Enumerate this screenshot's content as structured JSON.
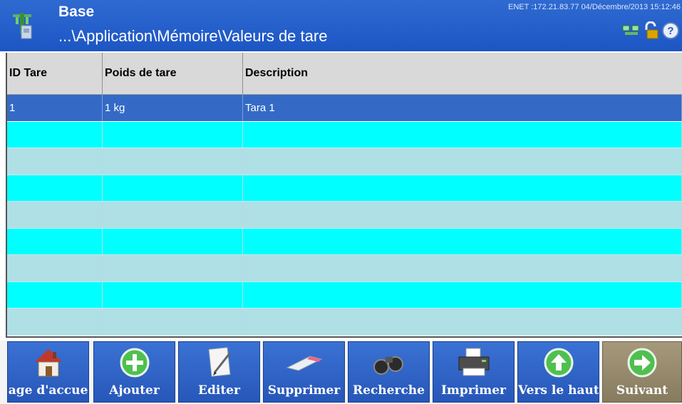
{
  "header": {
    "title": "Base",
    "path": "...\\Application\\Mémoire\\Valeurs de tare",
    "status": "ENET :172.21.83.77  04/Décembre/2013 15:12:46",
    "icons": [
      "network-icon",
      "unlock-icon",
      "help-icon"
    ]
  },
  "table": {
    "columns": [
      "ID Tare",
      "Poids de tare",
      "Description"
    ],
    "rows": [
      {
        "id": "1",
        "weight": "1 kg",
        "description": "Tara 1"
      }
    ],
    "selected_row_color": "#346ac6",
    "alt_colors": [
      "#00ffff",
      "#aee0e6"
    ]
  },
  "toolbar": {
    "buttons": [
      {
        "label": "age d'accue",
        "icon": "home-icon"
      },
      {
        "label": "Ajouter",
        "icon": "add-icon"
      },
      {
        "label": "Editer",
        "icon": "edit-icon"
      },
      {
        "label": "Supprimer",
        "icon": "eraser-icon"
      },
      {
        "label": "Recherche",
        "icon": "binoculars-icon"
      },
      {
        "label": "Imprimer",
        "icon": "printer-icon"
      },
      {
        "label": "Vers le haut",
        "icon": "arrow-up-icon"
      },
      {
        "label": "Suivant",
        "icon": "arrow-right-icon"
      }
    ]
  }
}
